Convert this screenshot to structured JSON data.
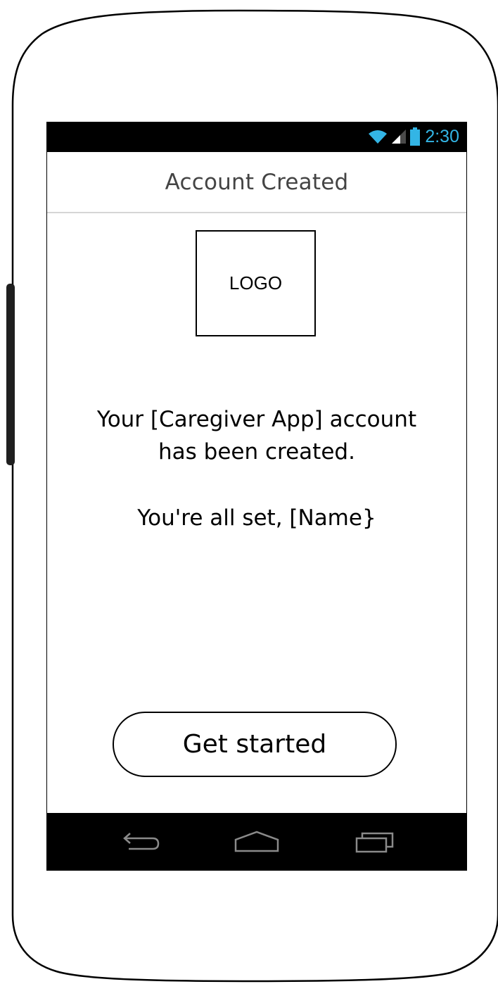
{
  "status_bar": {
    "time": "2:30",
    "icons": [
      "wifi-icon",
      "signal-icon",
      "battery-icon"
    ],
    "accent_color": "#33b5e5"
  },
  "header": {
    "title": "Account Created"
  },
  "logo": {
    "label": "LOGO"
  },
  "message": {
    "line1": "Your [Caregiver App] account",
    "line2": "has been created."
  },
  "greeting": "You're all set, [Name}",
  "primary_action": {
    "label": "Get started"
  },
  "nav_bar": {
    "buttons": [
      "back-icon",
      "home-icon",
      "recents-icon"
    ]
  }
}
